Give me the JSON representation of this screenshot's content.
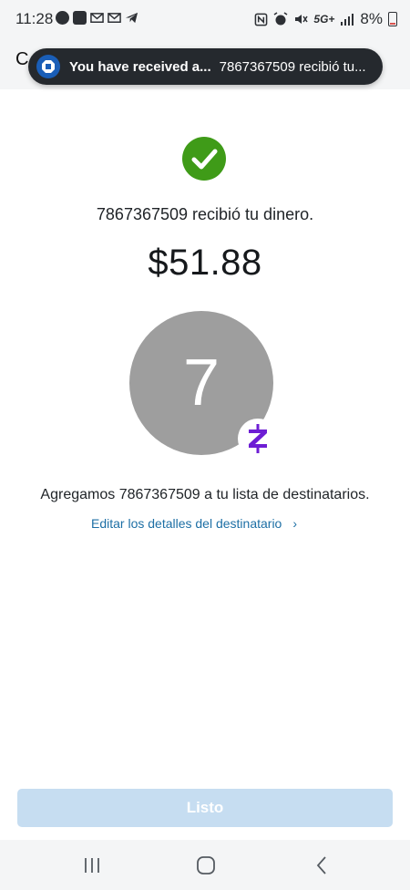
{
  "status_bar": {
    "time": "11:28",
    "network": "5G+",
    "battery_text": "8%"
  },
  "app_header": {
    "partial_letter": "C"
  },
  "notification": {
    "title": "You have received a...",
    "body": "7867367509 recibió tu..."
  },
  "confirmation": {
    "received_text": "7867367509 recibió tu dinero.",
    "amount": "$51.88",
    "avatar_initial": "7",
    "added_text": "Agregamos 7867367509 a tu lista de destinatarios.",
    "edit_link_label": "Editar los detalles del destinatario",
    "edit_link_chevron": "›"
  },
  "done_button": {
    "label": "Listo",
    "state": "disabled"
  },
  "colors": {
    "success_green": "#3f9b18",
    "zelle_purple": "#6d1ed4",
    "link_blue": "#1d6fa5",
    "button_disabled": "#c6ddf1",
    "toast_bg": "#25292e"
  },
  "icons": {
    "status_left": [
      "chase-icon",
      "check-box-icon",
      "gmail-icon",
      "gmail-icon",
      "telegram-icon"
    ],
    "status_right": [
      "nfc-icon",
      "alarm-icon",
      "mute-icon",
      "signal-icon",
      "battery-icon"
    ],
    "nav": [
      "recent-apps-icon",
      "home-icon",
      "back-icon"
    ]
  }
}
